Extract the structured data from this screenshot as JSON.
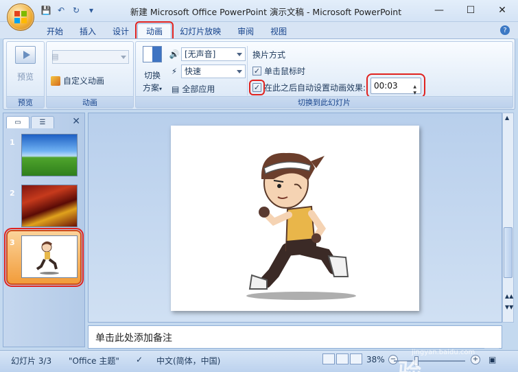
{
  "window": {
    "title": "新建 Microsoft Office PowerPoint 演示文稿 - Microsoft PowerPoint"
  },
  "tabs": [
    {
      "label": "开始"
    },
    {
      "label": "插入"
    },
    {
      "label": "设计"
    },
    {
      "label": "动画",
      "active": true
    },
    {
      "label": "幻灯片放映"
    },
    {
      "label": "审阅"
    },
    {
      "label": "视图"
    }
  ],
  "ribbon": {
    "preview_group": {
      "button_label": "预览",
      "group_label": "预览"
    },
    "animation_group": {
      "custom_animation_label": "自定义动画",
      "group_label": "动画"
    },
    "transition_group": {
      "scheme_label_line1": "切换",
      "scheme_label_line2": "方案",
      "sound_value": "[无声音]",
      "speed_value": "快速",
      "apply_all_label": "全部应用",
      "advance_title": "换片方式",
      "on_click_label": "单击鼠标时",
      "on_click_checked": true,
      "auto_after_label": "在此之后自动设置动画效果:",
      "auto_after_checked": true,
      "auto_after_time": "00:03",
      "group_label": "切换到此幻灯片"
    }
  },
  "slides_pane": {
    "slides": [
      {
        "number": "1"
      },
      {
        "number": "2"
      },
      {
        "number": "3",
        "selected": true
      }
    ]
  },
  "notes": {
    "placeholder": "单击此处添加备注"
  },
  "status": {
    "slide_counter": "幻灯片 3/3",
    "theme": "\"Office 主题\"",
    "language": "中文(简体，中国)",
    "zoom": "38%"
  },
  "watermark": {
    "text": "Baidu经验",
    "sub": "jingyan.baidu.com"
  },
  "colors": {
    "highlight_red": "#e0211e",
    "ribbon_blue": "#dce8f6",
    "slide_selected_orange": "#f29c3a"
  }
}
